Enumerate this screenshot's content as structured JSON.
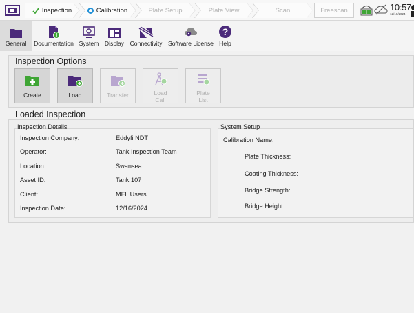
{
  "topbar": {
    "steps": [
      {
        "label": "Inspection",
        "state": "done",
        "icon": "check-icon"
      },
      {
        "label": "Calibration",
        "state": "active",
        "icon": "circle-icon"
      },
      {
        "label": "Plate Setup",
        "state": "inactive"
      },
      {
        "label": "Plate View",
        "state": "inactive"
      },
      {
        "label": "Scan",
        "state": "inactive"
      }
    ],
    "freescan_label": "Freescan",
    "time": "10:57",
    "date": "12/16/2024"
  },
  "ribbon": {
    "items": [
      {
        "label": "General",
        "icon": "folder-icon",
        "selected": true
      },
      {
        "label": "Documentation",
        "icon": "document-icon"
      },
      {
        "label": "System",
        "icon": "system-icon"
      },
      {
        "label": "Display",
        "icon": "display-icon"
      },
      {
        "label": "Connectivity",
        "icon": "connectivity-icon"
      },
      {
        "label": "Software License",
        "icon": "software-license-icon"
      },
      {
        "label": "Help",
        "icon": "help-icon"
      }
    ]
  },
  "inspection_options": {
    "title": "Inspection Options",
    "buttons": [
      {
        "label": "Create",
        "enabled": true,
        "icon": "create-icon"
      },
      {
        "label": "Load",
        "enabled": true,
        "icon": "load-icon"
      },
      {
        "label": "Transfer",
        "enabled": false,
        "icon": "transfer-icon"
      },
      {
        "label": "Load\nCal.",
        "enabled": false,
        "icon": "load-cal-icon"
      },
      {
        "label": "Plate\nList",
        "enabled": false,
        "icon": "plate-list-icon"
      }
    ]
  },
  "loaded_inspection": {
    "title": "Loaded Inspection",
    "details": {
      "title": "Inspection Details",
      "rows": [
        {
          "label": "Inspection Company:",
          "value": "Eddyfi NDT"
        },
        {
          "label": "Operator:",
          "value": "Tank Inspection Team"
        },
        {
          "label": "Location:",
          "value": "Swansea"
        },
        {
          "label": "Asset ID:",
          "value": "Tank 107"
        },
        {
          "label": "Client:",
          "value": "MFL Users"
        },
        {
          "label": "Inspection Date:",
          "value": "12/16/2024"
        }
      ]
    },
    "system_setup": {
      "title": "System Setup",
      "calibration_name_label": "Calibration Name:",
      "rows": [
        {
          "label": "Plate Thickness:"
        },
        {
          "label": "Coating Thickness:"
        },
        {
          "label": "Bridge Strength:"
        },
        {
          "label": "Bridge Height:"
        }
      ]
    }
  },
  "colors": {
    "accent": "#4b2a7a",
    "success": "#3fa535",
    "active_step": "#1f8fd6",
    "disabled": "#b8a6cf"
  }
}
